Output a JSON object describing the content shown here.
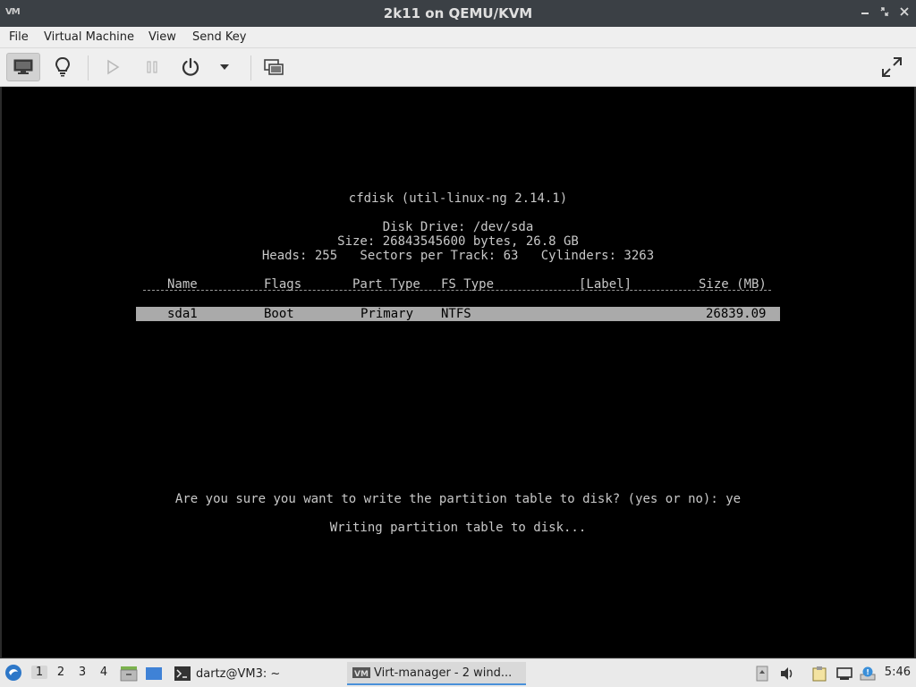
{
  "window": {
    "title": "2k11 on QEMU/KVM",
    "app_icon": "VM",
    "controls": [
      "minimize-icon",
      "restore-icon",
      "close-icon"
    ]
  },
  "menu": {
    "items": [
      "File",
      "Virtual Machine",
      "View",
      "Send Key"
    ]
  },
  "toolbar": {
    "icons": [
      "monitor-icon",
      "lightbulb-icon",
      "play-icon",
      "pause-icon",
      "power-icon",
      "dropdown-arrow-icon",
      "screenshot-icon",
      "fullscreen-icon"
    ]
  },
  "console": {
    "header": "cfdisk (util-linux-ng 2.14.1)",
    "disk_drive": "Disk Drive: /dev/sda",
    "size_line": "Size: 26843545600 bytes, 26.8 GB",
    "geometry_line": "Heads: 255   Sectors per Track: 63   Cylinders: 3263",
    "columns": {
      "name": "Name",
      "flags": "Flags",
      "part_type": "Part Type",
      "fs_type": "FS Type",
      "label": "[Label]",
      "size": "Size (MB)"
    },
    "rows": [
      {
        "name": "sda1",
        "flags": "Boot",
        "part_type": "Primary",
        "fs_type": "NTFS",
        "label": "",
        "size": "26839.09"
      }
    ],
    "prompt": "Are you sure you want to write the partition table to disk? (yes or no): ye",
    "status": "Writing partition table to disk..."
  },
  "taskbar": {
    "workspaces": [
      "1",
      "2",
      "3",
      "4"
    ],
    "active_workspace": "1",
    "tasks": [
      {
        "label": "dartz@VM3: ~",
        "icon": "terminal-icon"
      },
      {
        "label": "Virt-manager - 2 wind...",
        "icon": "virt-manager-icon"
      }
    ],
    "clock": "5:46"
  }
}
